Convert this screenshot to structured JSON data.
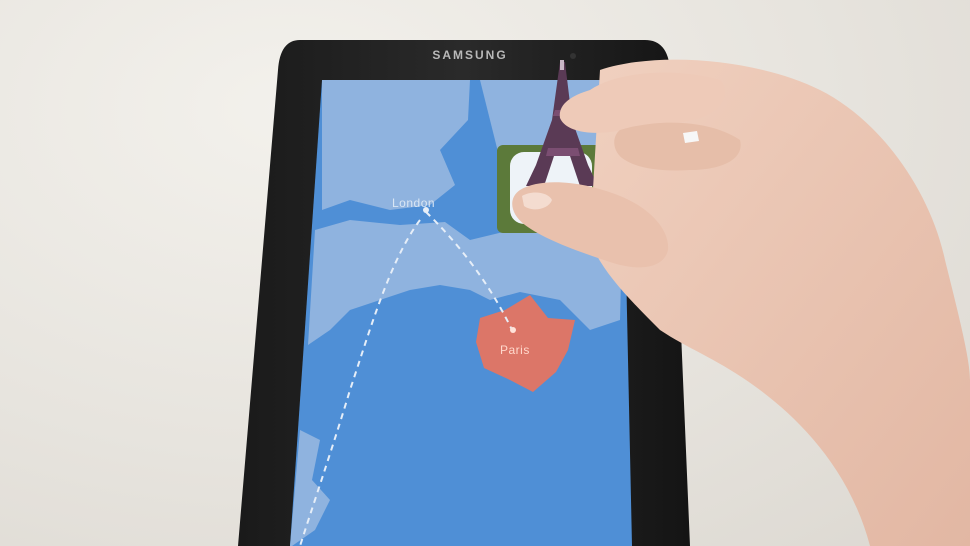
{
  "device": {
    "brand": "SAMSUNG"
  },
  "map": {
    "cities": [
      {
        "name": "London"
      },
      {
        "name": "Paris"
      }
    ],
    "colors": {
      "sea": "#4f8fd6",
      "land": "#8fb3df",
      "highlight": "#e8745e",
      "route": "#e6eef8"
    },
    "route_style": "dashed"
  },
  "objects": {
    "figurine": "eiffel-tower-icon",
    "hand": "hand"
  }
}
